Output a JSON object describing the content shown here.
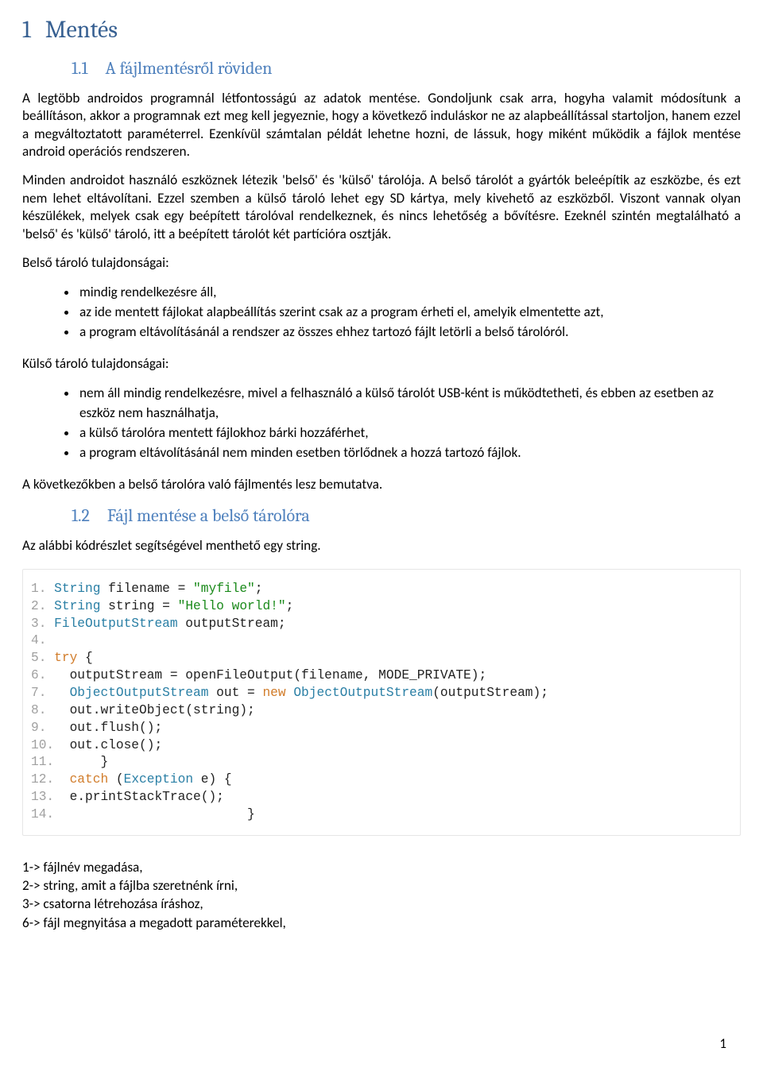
{
  "h1": {
    "num": "1",
    "text": "Mentés"
  },
  "s11": {
    "num": "1.1",
    "text": "A fájlmentésről röviden"
  },
  "p1": "A legtöbb androidos programnál létfontosságú az adatok mentése. Gondoljunk csak arra, hogyha valamit módosítunk a beállításon, akkor a programnak ezt meg kell jegyeznie, hogy a következő induláskor ne az alapbeállítással startoljon, hanem ezzel a megváltoztatott paraméterrel. Ezenkívül számtalan példát lehetne hozni, de lássuk, hogy miként működik a fájlok mentése android operációs rendszeren.",
  "p2": "Minden androidot használó eszköznek létezik 'belső' és 'külső' tárolója. A belső tárolót a gyártók beleépítik az eszközbe, és ezt nem lehet eltávolítani. Ezzel szemben a külső tároló lehet egy SD kártya, mely kivehető az eszközből. Viszont vannak olyan készülékek, melyek csak egy beépített tárolóval rendelkeznek, és nincs lehetőség a bővítésre. Ezeknél szintén megtalálható a 'belső' és 'külső' tároló, itt a beépített tárolót két partícióra osztják.",
  "p3": "Belső tároló tulajdonságai:",
  "list1": [
    "mindig rendelkezésre áll,",
    "az ide mentett fájlokat alapbeállítás szerint csak az a program érheti el, amelyik elmentette azt,",
    "a program eltávolításánál a rendszer az összes ehhez tartozó fájlt letörli a belső tárolóról."
  ],
  "p4": "Külső tároló tulajdonságai:",
  "list2": [
    "nem áll mindig rendelkezésre, mivel a felhasználó a külső tárolót USB-ként is működtetheti, és ebben az esetben az eszköz nem használhatja,",
    "a külső tárolóra mentett fájlokhoz bárki hozzáférhet,",
    "a program eltávolításánál nem minden esetben törlődnek a hozzá tartozó fájlok."
  ],
  "p5": "A következőkben a belső tárolóra való fájlmentés lesz bemutatva.",
  "s12": {
    "num": "1.2",
    "text": "Fájl mentése a belső tárolóra"
  },
  "p6": "Az alábbi kódrészlet segítségével menthető egy string.",
  "code": [
    {
      "n": "1.",
      "tokens": [
        {
          "t": " ",
          "c": "plain"
        },
        {
          "t": "String",
          "c": "var"
        },
        {
          "t": " filename ",
          "c": "plain"
        },
        {
          "t": "=",
          "c": "plain"
        },
        {
          "t": " ",
          "c": "plain"
        },
        {
          "t": "\"myfile\"",
          "c": "str"
        },
        {
          "t": ";",
          "c": "plain"
        }
      ]
    },
    {
      "n": "2.",
      "tokens": [
        {
          "t": " ",
          "c": "plain"
        },
        {
          "t": "String",
          "c": "var"
        },
        {
          "t": " string ",
          "c": "plain"
        },
        {
          "t": "=",
          "c": "plain"
        },
        {
          "t": " ",
          "c": "plain"
        },
        {
          "t": "\"Hello world!\"",
          "c": "str"
        },
        {
          "t": ";",
          "c": "plain"
        }
      ]
    },
    {
      "n": "3.",
      "tokens": [
        {
          "t": " ",
          "c": "plain"
        },
        {
          "t": "FileOutputStream",
          "c": "var"
        },
        {
          "t": " outputStream",
          "c": "plain"
        },
        {
          "t": ";",
          "c": "plain"
        }
      ]
    },
    {
      "n": "4.",
      "tokens": []
    },
    {
      "n": "5.",
      "tokens": [
        {
          "t": " ",
          "c": "plain"
        },
        {
          "t": "try",
          "c": "kw"
        },
        {
          "t": " {",
          "c": "plain"
        }
      ]
    },
    {
      "n": "6.",
      "tokens": [
        {
          "t": "   outputStream ",
          "c": "plain"
        },
        {
          "t": "=",
          "c": "plain"
        },
        {
          "t": " openFileOutput",
          "c": "plain"
        },
        {
          "t": "(",
          "c": "plain"
        },
        {
          "t": "filename",
          "c": "plain"
        },
        {
          "t": ",",
          "c": "plain"
        },
        {
          "t": " MODE_PRIVATE",
          "c": "plain"
        },
        {
          "t": ");",
          "c": "plain"
        }
      ]
    },
    {
      "n": "7.",
      "tokens": [
        {
          "t": "   ",
          "c": "plain"
        },
        {
          "t": "ObjectOutputStream",
          "c": "var"
        },
        {
          "t": " out ",
          "c": "plain"
        },
        {
          "t": "=",
          "c": "plain"
        },
        {
          "t": " ",
          "c": "plain"
        },
        {
          "t": "new",
          "c": "kw"
        },
        {
          "t": " ",
          "c": "plain"
        },
        {
          "t": "ObjectOutputStream",
          "c": "var"
        },
        {
          "t": "(",
          "c": "plain"
        },
        {
          "t": "outputStream",
          "c": "plain"
        },
        {
          "t": ");",
          "c": "plain"
        }
      ]
    },
    {
      "n": "8.",
      "tokens": [
        {
          "t": "   out",
          "c": "plain"
        },
        {
          "t": ".",
          "c": "plain"
        },
        {
          "t": "writeObject",
          "c": "plain"
        },
        {
          "t": "(",
          "c": "plain"
        },
        {
          "t": "string",
          "c": "plain"
        },
        {
          "t": ");",
          "c": "plain"
        }
      ]
    },
    {
      "n": "9.",
      "tokens": [
        {
          "t": "   out",
          "c": "plain"
        },
        {
          "t": ".",
          "c": "plain"
        },
        {
          "t": "flush",
          "c": "plain"
        },
        {
          "t": "();",
          "c": "plain"
        }
      ]
    },
    {
      "n": "10.",
      "tokens": [
        {
          "t": "  out",
          "c": "plain"
        },
        {
          "t": ".",
          "c": "plain"
        },
        {
          "t": "close",
          "c": "plain"
        },
        {
          "t": "();",
          "c": "plain"
        }
      ]
    },
    {
      "n": "11.",
      "tokens": [
        {
          "t": "      }",
          "c": "plain"
        }
      ]
    },
    {
      "n": "12.",
      "tokens": [
        {
          "t": "  ",
          "c": "plain"
        },
        {
          "t": "catch",
          "c": "kw"
        },
        {
          "t": " ",
          "c": "plain"
        },
        {
          "t": "(",
          "c": "plain"
        },
        {
          "t": "Exception",
          "c": "var"
        },
        {
          "t": " e",
          "c": "plain"
        },
        {
          "t": ")",
          "c": "plain"
        },
        {
          "t": " {",
          "c": "plain"
        }
      ]
    },
    {
      "n": "13.",
      "tokens": [
        {
          "t": "  e",
          "c": "plain"
        },
        {
          "t": ".",
          "c": "plain"
        },
        {
          "t": "printStackTrace",
          "c": "plain"
        },
        {
          "t": "();",
          "c": "plain"
        }
      ]
    },
    {
      "n": "14.",
      "tokens": [
        {
          "t": "                         }",
          "c": "plain"
        }
      ]
    }
  ],
  "explain": [
    "1-> fájlnév megadása,",
    "2-> string, amit a fájlba szeretnénk írni,",
    "3-> csatorna létrehozása íráshoz,",
    "6-> fájl megnyitása a megadott paraméterekkel,"
  ],
  "pageNumber": "1"
}
